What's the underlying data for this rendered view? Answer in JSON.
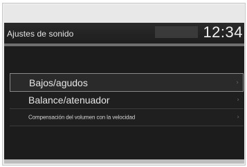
{
  "header": {
    "title": "Ajustes de sonido",
    "clock": "12:34"
  },
  "menu": {
    "items": [
      {
        "label": "Bajos/agudos",
        "chevron": "›",
        "icon": "chevron-right-icon",
        "selected": true
      },
      {
        "label": "Balance/atenuador",
        "chevron": "›",
        "icon": "chevron-right-icon",
        "selected": false
      },
      {
        "label": "Compensación del volumen con la velocidad",
        "chevron": "›",
        "icon": "chevron-right-icon",
        "selected": false
      }
    ]
  },
  "colors": {
    "screen_bg": "#1c1c1c",
    "text": "#e6e6e6",
    "selected_border": "#8a8a8a"
  }
}
